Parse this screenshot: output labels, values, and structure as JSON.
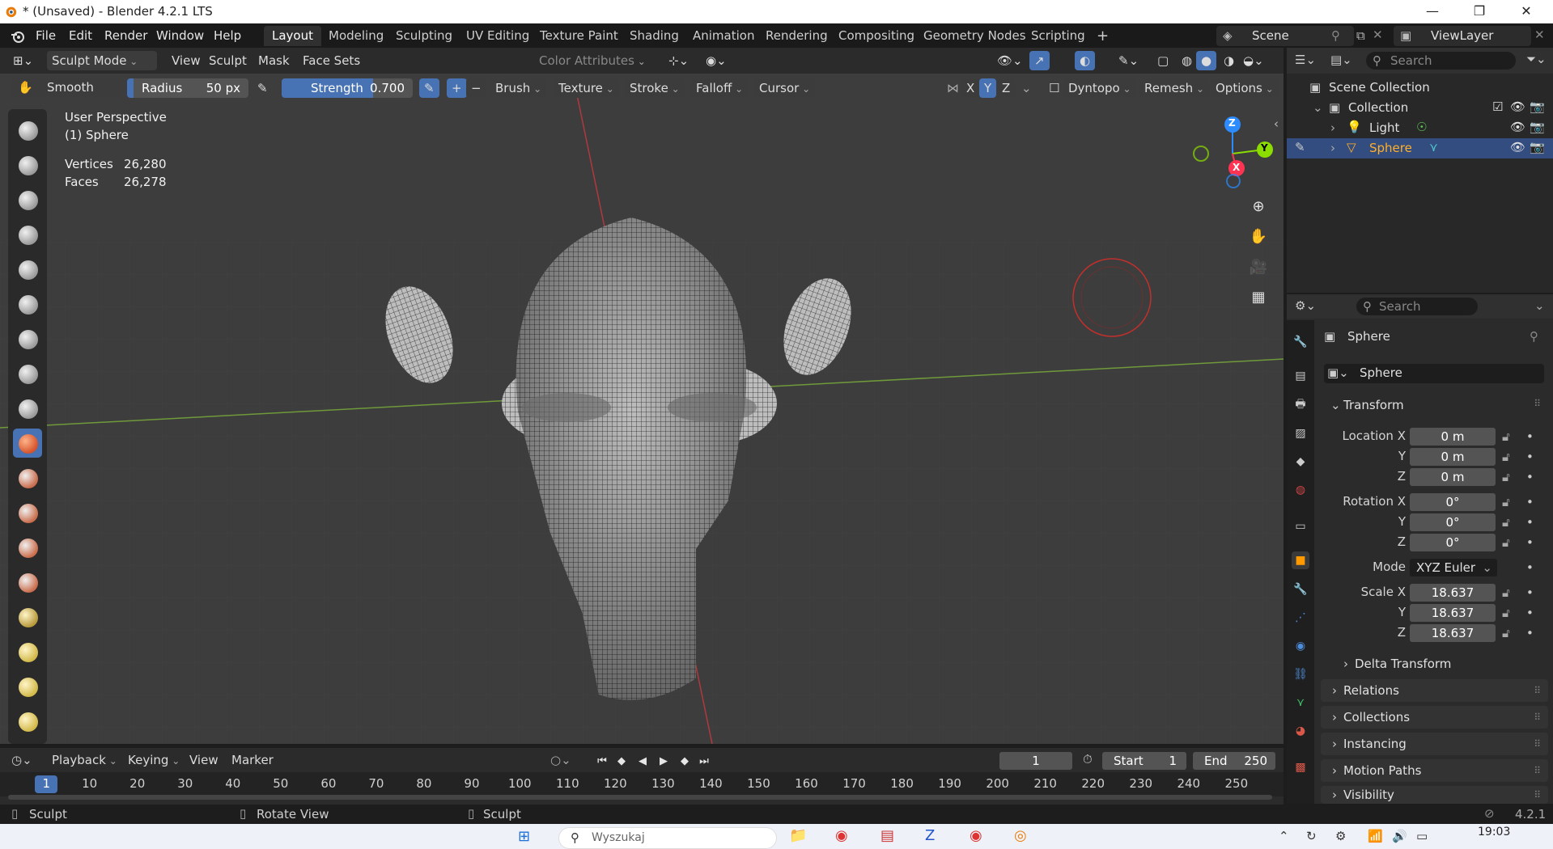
{
  "window": {
    "title": "* (Unsaved) - Blender 4.2.1 LTS",
    "controls": [
      "—",
      "❐",
      "✕"
    ]
  },
  "menubar": {
    "items": [
      "File",
      "Edit",
      "Render",
      "Window",
      "Help"
    ],
    "workspaces": [
      "Layout",
      "Modeling",
      "Sculpting",
      "UV Editing",
      "Texture Paint",
      "Shading",
      "Animation",
      "Rendering",
      "Compositing",
      "Geometry Nodes",
      "Scripting"
    ],
    "active_workspace": "Layout",
    "add_tab": "+",
    "scene": "Scene",
    "view_layer": "ViewLayer"
  },
  "viewport_header": {
    "mode": "Sculpt Mode",
    "menus": [
      "View",
      "Sculpt",
      "Mask",
      "Face Sets"
    ],
    "color_attributes": "Color Attributes"
  },
  "tool_header": {
    "brush_name": "Smooth",
    "radius_label": "Radius",
    "radius_value": "50 px",
    "strength_label": "Strength",
    "strength_value": "0.700",
    "strength_fraction": 0.7,
    "plus": "+",
    "minus": "−",
    "menus": [
      "Brush",
      "Texture",
      "Stroke",
      "Falloff",
      "Cursor"
    ],
    "axes": [
      "X",
      "Y",
      "Z"
    ],
    "dyntopo": "Dyntopo",
    "remesh": "Remesh",
    "options": "Options"
  },
  "overlay": {
    "perspective": "User Perspective",
    "object": "(1) Sphere",
    "vertices_label": "Vertices",
    "vertices_value": "26,280",
    "faces_label": "Faces",
    "faces_value": "26,278"
  },
  "gizmo": {
    "x": "X",
    "y": "Y",
    "z": "Z"
  },
  "outliner": {
    "search_placeholder": "Search",
    "scene_collection": "Scene Collection",
    "collection": "Collection",
    "items": [
      {
        "name": "Light"
      },
      {
        "name": "Sphere"
      }
    ]
  },
  "properties": {
    "search_placeholder": "Search",
    "object_name": "Sphere",
    "data_name": "Sphere",
    "transform_label": "Transform",
    "location_label": "Location X",
    "rotation_label": "Rotation X",
    "scale_label": "Scale X",
    "y_label": "Y",
    "z_label": "Z",
    "location": [
      "0 m",
      "0 m",
      "0 m"
    ],
    "rotation": [
      "0°",
      "0°",
      "0°"
    ],
    "mode_label": "Mode",
    "mode_value": "XYZ Euler",
    "scale": [
      "18.637",
      "18.637",
      "18.637"
    ],
    "panels": [
      "Delta Transform",
      "Relations",
      "Collections",
      "Instancing",
      "Motion Paths",
      "Visibility"
    ]
  },
  "timeline": {
    "menus": [
      "Playback",
      "Keying",
      "View",
      "Marker"
    ],
    "current_frame": "1",
    "start_label": "Start",
    "start_value": "1",
    "end_label": "End",
    "end_value": "250",
    "ruler": [
      "1",
      "10",
      "20",
      "30",
      "40",
      "50",
      "60",
      "70",
      "80",
      "90",
      "100",
      "110",
      "120",
      "130",
      "140",
      "150",
      "160",
      "170",
      "180",
      "190",
      "200",
      "210",
      "220",
      "230",
      "240",
      "250"
    ]
  },
  "statusbar": {
    "left": "Sculpt",
    "middle": "Rotate View",
    "right": "Sculpt",
    "version": "4.2.1"
  },
  "taskbar": {
    "search_placeholder": "Wyszukaj",
    "time": "19:03"
  },
  "colors": {
    "accent": "#4772b3",
    "selected_object": "#ffaf29",
    "axis_x": "#ff3352",
    "axis_y": "#8bdc00",
    "axis_z": "#2b8bff"
  }
}
